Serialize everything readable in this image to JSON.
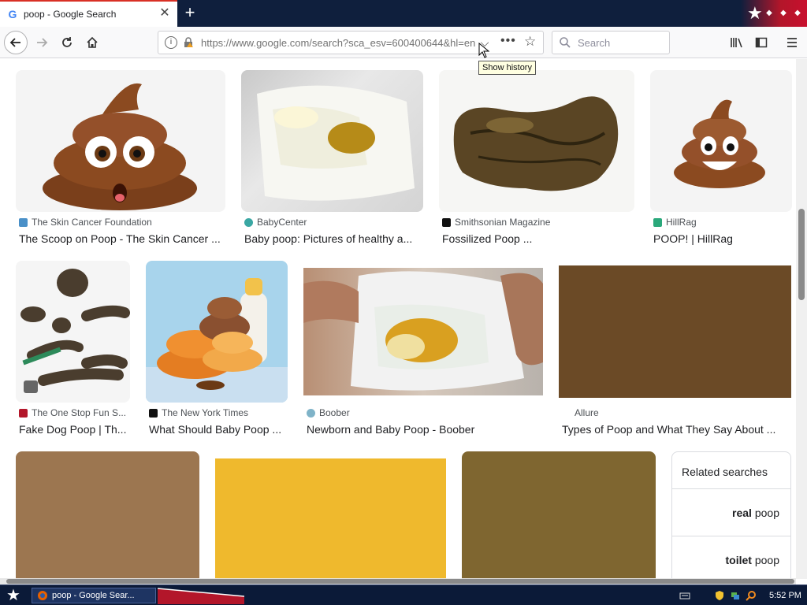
{
  "browser": {
    "tab": {
      "title": "poop - Google Search",
      "favicon": "google-g-icon"
    },
    "url": "https://www.google.com/search?sca_esv=600400644&hl=en",
    "search_placeholder": "Search",
    "tooltip": "Show history"
  },
  "results": {
    "row1": [
      {
        "source": "The Skin Cancer Foundation",
        "title": "The Scoop on Poop - The Skin Cancer ...",
        "icon_color": "#4a90c8"
      },
      {
        "source": "BabyCenter",
        "title": "Baby poop: Pictures of healthy a...",
        "icon_color": "#3aa7a3"
      },
      {
        "source": "Smithsonian Magazine",
        "title": "Fossilized Poop ...",
        "icon_color": "#111111"
      },
      {
        "source": "HillRag",
        "title": "POOP! | HillRag",
        "icon_color": "#2aa87b"
      }
    ],
    "row2": [
      {
        "source": "The One Stop Fun S...",
        "title": "Fake Dog Poop | Th...",
        "icon_color": "#b3162a"
      },
      {
        "source": "The New York Times",
        "title": "What Should Baby Poop ...",
        "icon_color": "#111111"
      },
      {
        "source": "Boober",
        "title": "Newborn and Baby Poop - Boober",
        "icon_color": "#7fb3c8"
      },
      {
        "source": "Allure",
        "title": "Types of Poop and What They Say About ...",
        "icon_color": "#ffffff"
      }
    ]
  },
  "colors": {
    "placeholder_brown_1": "#6b4a26",
    "placeholder_tan": "#9c7650",
    "placeholder_yellow": "#efb92d",
    "placeholder_olive": "#7f6630"
  },
  "related": {
    "title": "Related searches",
    "items": [
      {
        "bold": "real",
        "rest": " poop"
      },
      {
        "bold": "toilet",
        "rest": " poop"
      }
    ]
  },
  "taskbar": {
    "task_label": "poop - Google Sear...",
    "clock": "5:52 PM"
  }
}
